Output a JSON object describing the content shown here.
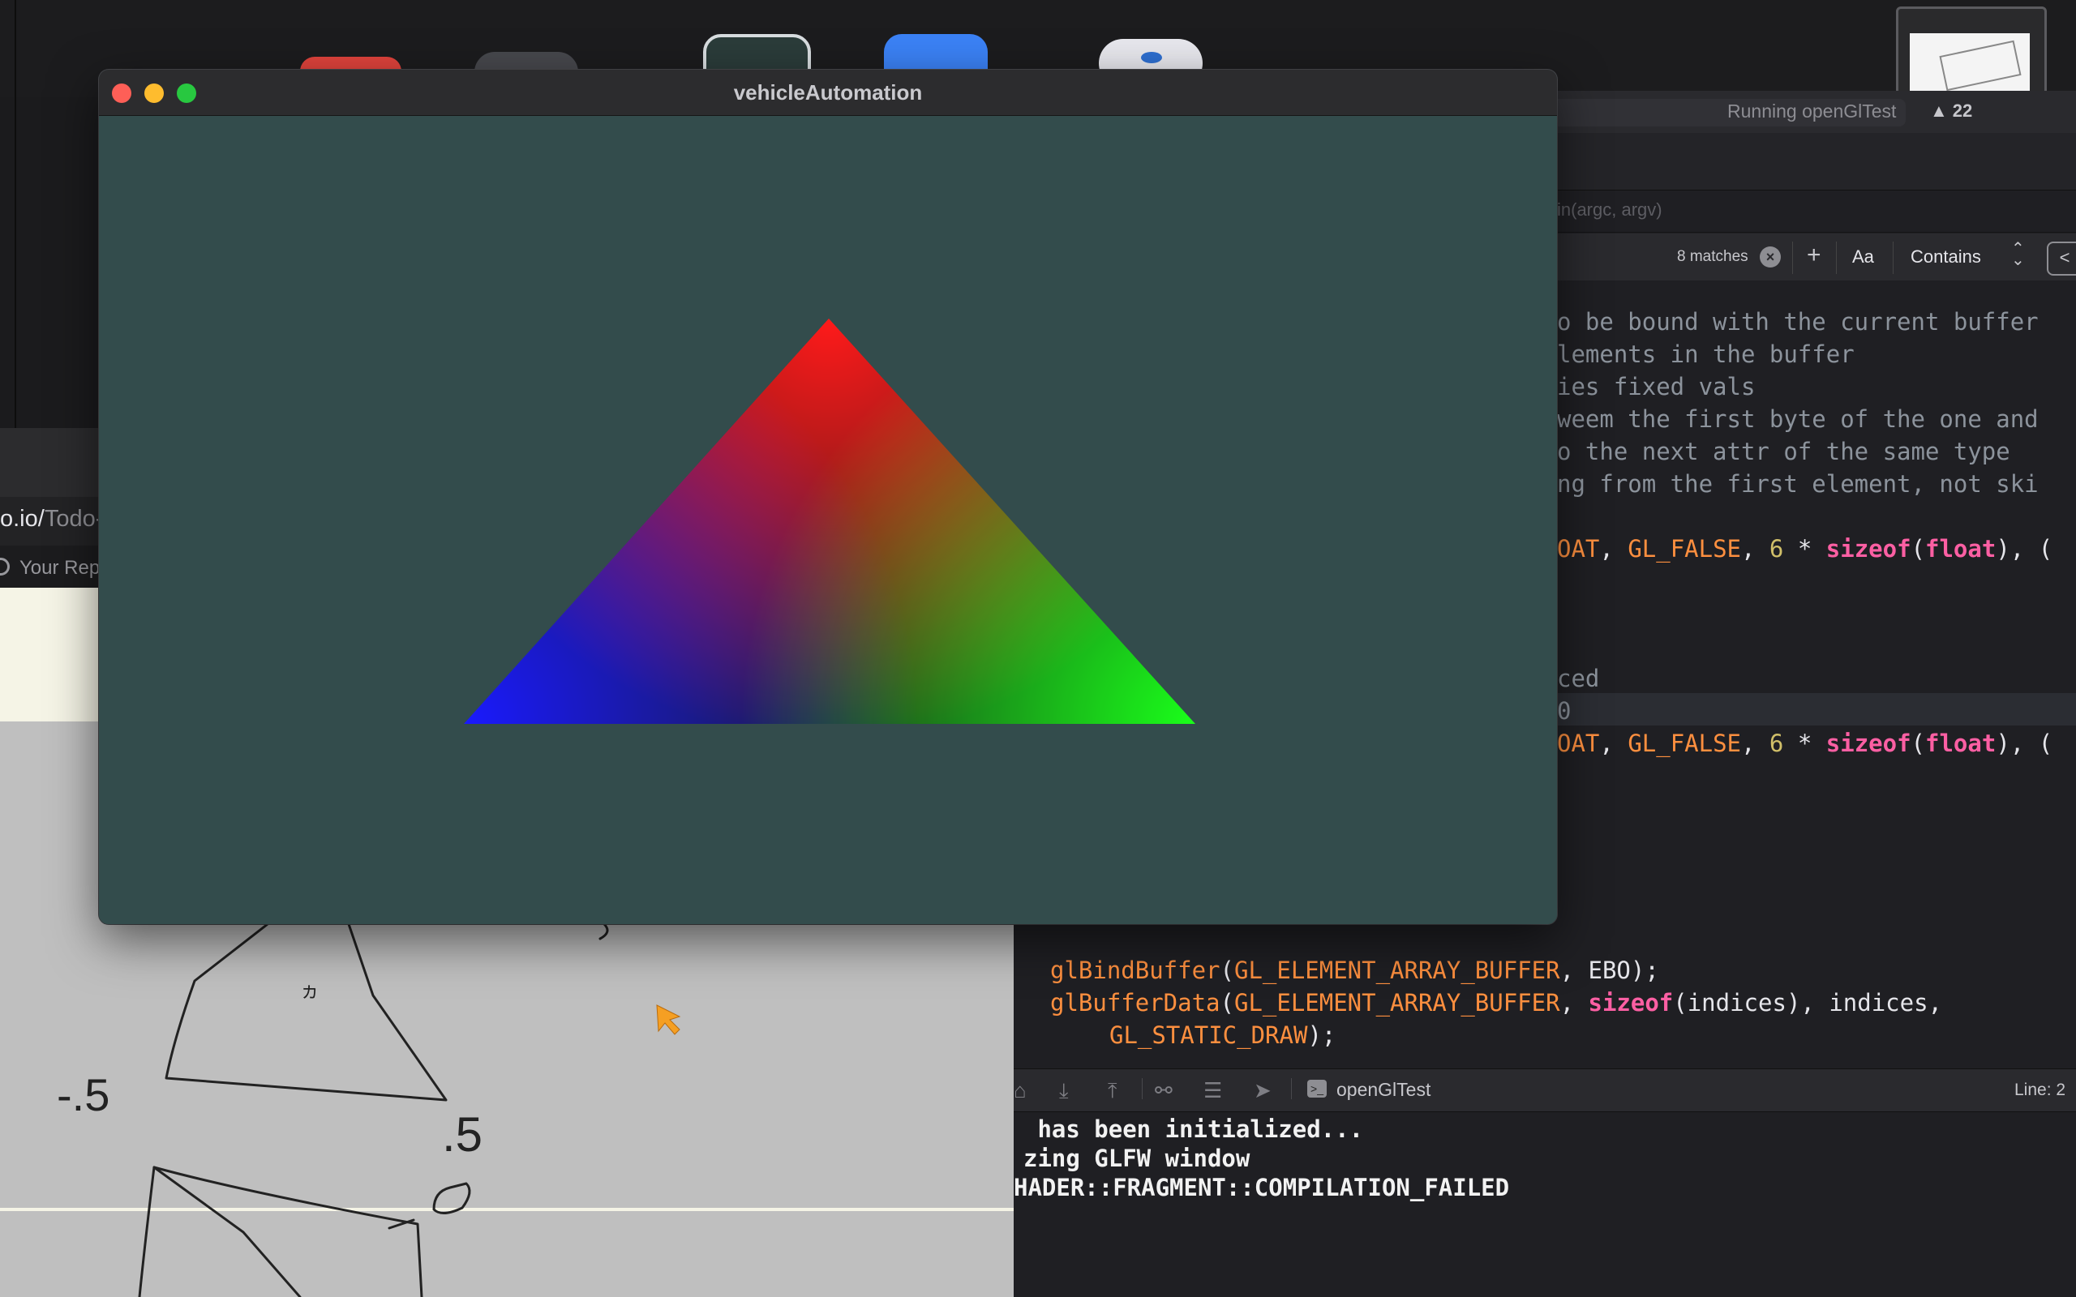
{
  "gl_window": {
    "title": "vehicleAutomation",
    "clear_color": "#334c4c",
    "triangle": {
      "top_vertex_color": "#ff0000",
      "right_vertex_color": "#00ff00",
      "left_vertex_color": "#0000ff"
    }
  },
  "xcode": {
    "activity_status": "Running openGlTest",
    "warning_count": "22",
    "jump_bar": "in(argc, argv)",
    "find": {
      "matches": "8 matches",
      "add_label": "+",
      "case_label": "Aa",
      "mode": "Contains",
      "prev_label": "<"
    },
    "code_lines": [
      "o be bound with the current buffer",
      "lements in the buffer",
      "ies fixed vals",
      "weem the first byte of the one and",
      "o the next attr of the same type",
      "ng from the first element, not ski",
      "ced",
      "0"
    ],
    "attrib_call_1": {
      "a": "OAT",
      "b": "GL_FALSE",
      "c": "6",
      "d": "sizeof",
      "e": "float"
    },
    "attrib_call_2": {
      "a": "OAT",
      "b": "GL_FALSE",
      "c": "6",
      "d": "sizeof",
      "e": "float"
    },
    "bind_buffer": {
      "fn": "glBindBuffer",
      "target": "GL_ELEMENT_ARRAY_BUFFER",
      "arg": "EBO"
    },
    "buffer_data": {
      "fn": "glBufferData",
      "target": "GL_ELEMENT_ARRAY_BUFFER",
      "sizeof": "sizeof",
      "arg1": "indices",
      "arg2": "indices",
      "usage": "GL_STATIC_DRAW"
    },
    "debug_target": "openGlTest",
    "line_indicator": "Line: 2",
    "console_lines": [
      " has been initialized...",
      "zing GLFW window",
      "HADER::FRAGMENT::COMPILATION_FAILED"
    ]
  },
  "browser": {
    "url_domain": "o.io/",
    "url_path": "Todo-",
    "tab_title": "Your Rep"
  },
  "sketch_labels": {
    "neg_half": "-.5",
    "pos_half": ".5"
  }
}
